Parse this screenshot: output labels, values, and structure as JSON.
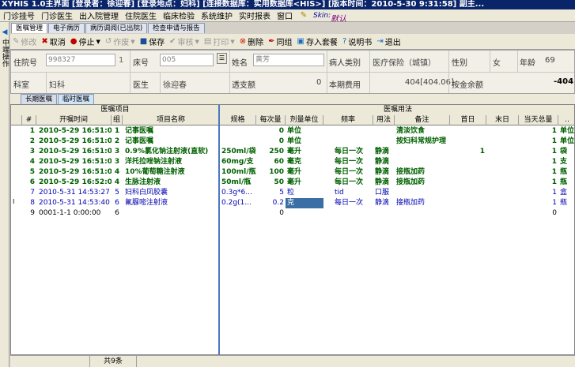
{
  "window": {
    "title": "XYHIS 1.0主界面  [登录者：徐迎春] [登录地点：妇科] [连接数据库：实用数据库<HIS>] [版本时间：2010-5-30 9:31:58] 副主..."
  },
  "menu": {
    "items": [
      "门诊挂号",
      "门诊医生",
      "出入院管理",
      "住院医生",
      "临床检验",
      "系统维护",
      "实时报表",
      "窗口"
    ],
    "skin_label": "Skin:",
    "skin_value": "默认"
  },
  "sidebar": {
    "label": "中端操作"
  },
  "top_tabs": [
    "医嘱管理",
    "电子病历",
    "病历调阅(已出院)",
    "检查申请与报告"
  ],
  "toolbar": {
    "modify": "修改",
    "cancel": "取消",
    "stop": "停止",
    "void": "作废",
    "save": "保存",
    "review": "审核",
    "print": "打印",
    "delete": "删除",
    "group": "同组",
    "save_set": "存入套餐",
    "manual": "说明书",
    "exit": "退出"
  },
  "patient": {
    "inpatient_no_label": "住院号",
    "inpatient_no": "998327",
    "inpatient_suffix": "1",
    "bed_label": "床号",
    "bed": "005",
    "name_label": "姓名",
    "name": "黄芳",
    "category_label": "病人类别",
    "category": "医疗保险（城镇）",
    "sex_label": "性别",
    "sex": "女",
    "age_label": "年龄",
    "age": "69",
    "dept_label": "科室",
    "dept": "妇科",
    "doctor_label": "医生",
    "doctor": "徐迎春",
    "overdraft_label": "透支额",
    "overdraft": "0",
    "period_cost_label": "本期费用",
    "period_cost": "404[404.06]",
    "deposit_balance_label": "按金余额",
    "deposit_balance": "-404"
  },
  "order_tabs": [
    "长期医嘱",
    "临时医嘱"
  ],
  "grid": {
    "group_headers": {
      "left": "医嘱项目",
      "right": "医嘱用法"
    },
    "columns": [
      "#",
      "开嘱时间",
      "组",
      "项目名称",
      "规格",
      "每次量",
      "剂量单位",
      "频率",
      "用法",
      "备注",
      "首日",
      "末日",
      "当天总量",
      ".."
    ],
    "rows": [
      {
        "no": "1",
        "time": "2010-5-29 16:51:00",
        "grp": "1",
        "name": "记事医嘱",
        "spec": "",
        "qty": "0",
        "unit": "单位",
        "freq": "",
        "usage": "",
        "note": "清淡饮食",
        "first": "",
        "last": "",
        "total": "1",
        "more": "单位",
        "style": "g"
      },
      {
        "no": "2",
        "time": "2010-5-29 16:51:00",
        "grp": "2",
        "name": "记事医嘱",
        "spec": "",
        "qty": "0",
        "unit": "单位",
        "freq": "",
        "usage": "",
        "note": "按妇科常规护理",
        "first": "",
        "last": "",
        "total": "1",
        "more": "单位",
        "style": "g"
      },
      {
        "no": "3",
        "time": "2010-5-29 16:51:00",
        "grp": "3",
        "name": "0.9%氯化钠注射液(直软)",
        "spec": "250ml/袋",
        "qty": "250",
        "unit": "毫升",
        "freq": "每日一次",
        "usage": "静滴",
        "note": "",
        "first": "1",
        "last": "",
        "total": "1",
        "more": "袋",
        "style": "g"
      },
      {
        "no": "4",
        "time": "2010-5-29 16:51:00",
        "grp": "3",
        "name": "洋托拉唑钠注射液",
        "spec": "60mg/支",
        "qty": "60",
        "unit": "毫克",
        "freq": "每日一次",
        "usage": "静滴",
        "note": "",
        "first": "",
        "last": "",
        "total": "1",
        "more": "支",
        "style": "g"
      },
      {
        "no": "5",
        "time": "2010-5-29 16:51:00",
        "grp": "4",
        "name": "10%葡萄糖注射液",
        "spec": "100ml/瓶",
        "qty": "100",
        "unit": "毫升",
        "freq": "每日一次",
        "usage": "静滴",
        "note": "接瓶加药",
        "first": "",
        "last": "",
        "total": "1",
        "more": "瓶",
        "style": "g"
      },
      {
        "no": "6",
        "time": "2010-5-29 16:52:00",
        "grp": "4",
        "name": "生脉注射液",
        "spec": "50ml/瓶",
        "qty": "50",
        "unit": "毫升",
        "freq": "每日一次",
        "usage": "静滴",
        "note": "接瓶加药",
        "first": "",
        "last": "",
        "total": "1",
        "more": "瓶",
        "style": "g"
      },
      {
        "no": "7",
        "time": "2010-5-31 14:53:27",
        "grp": "5",
        "name": "妇科白凤胶囊",
        "spec": "0.3g*6...",
        "qty": "5",
        "unit": "粒",
        "freq": "tid",
        "usage": "口服",
        "note": "",
        "first": "",
        "last": "",
        "total": "1",
        "more": "盒",
        "style": "b"
      },
      {
        "no": "8",
        "time": "2010-5-31 14:53:40",
        "grp": "6",
        "name": "氟脲嘧注射液",
        "spec": "0.2g(1...",
        "qty": "0.2",
        "unit": "克",
        "freq": "每日一次",
        "usage": "静滴",
        "note": "接瓶加药",
        "first": "",
        "last": "",
        "total": "1",
        "more": "瓶",
        "style": "b"
      },
      {
        "no": "9",
        "time": "0001-1-1 0:00:00",
        "grp": "6",
        "name": "",
        "spec": "",
        "qty": "0",
        "unit": "",
        "freq": "",
        "usage": "",
        "note": "",
        "first": "",
        "last": "",
        "total": "0",
        "more": "",
        "style": "k"
      }
    ]
  },
  "status": {
    "count": "共9条"
  },
  "colors": {
    "title_bg": "#0a246a",
    "green_row": "#006000",
    "blue_row": "#0000b0",
    "selection": "#3a6ea5"
  },
  "icons": [
    "sidebar-toggle-icon",
    "edit-icon",
    "cancel-icon",
    "stop-icon",
    "void-icon",
    "save-icon",
    "review-icon",
    "print-icon",
    "delete-icon",
    "group-icon",
    "save-set-icon",
    "help-icon",
    "exit-icon",
    "skin-icon"
  ]
}
